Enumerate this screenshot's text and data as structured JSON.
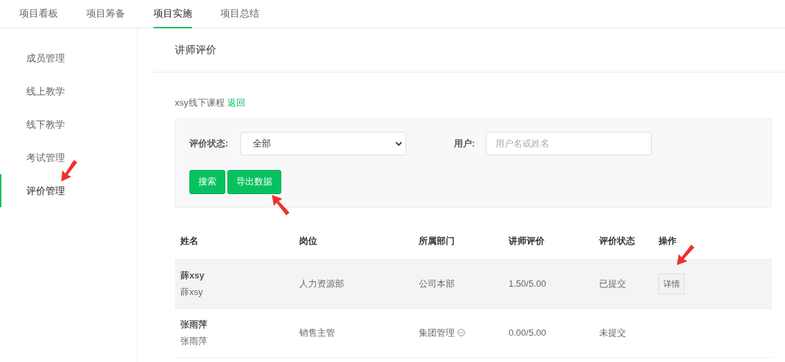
{
  "tabs": [
    {
      "label": "项目看板",
      "selected": false
    },
    {
      "label": "项目筹备",
      "selected": false
    },
    {
      "label": "项目实施",
      "selected": true
    },
    {
      "label": "项目总结",
      "selected": false
    }
  ],
  "sidebar": {
    "items": [
      {
        "label": "成员管理",
        "selected": false
      },
      {
        "label": "线上教学",
        "selected": false
      },
      {
        "label": "线下教学",
        "selected": false
      },
      {
        "label": "考试管理",
        "selected": false
      },
      {
        "label": "评价管理",
        "selected": true
      }
    ]
  },
  "page_title": "讲师评价",
  "course": {
    "name": "xsy线下课程",
    "back_link": "返回"
  },
  "filters": {
    "status_label": "评价状态:",
    "status_value": "全部",
    "user_label": "用户:",
    "user_placeholder": "用户名或姓名",
    "buttons": [
      "搜索",
      "导出数据"
    ]
  },
  "table": {
    "columns": [
      "姓名",
      "岗位",
      "所属部门",
      "讲师评价",
      "评价状态",
      "操作"
    ],
    "rows": [
      {
        "name": "薛xsy",
        "username": "薛xsy",
        "position": "人力资源部",
        "department": "公司本部",
        "info_icon": false,
        "rating": "1.50/5.00",
        "status": "已提交",
        "action": "详情",
        "selected": true
      },
      {
        "name": "张雨萍",
        "username": "张雨萍",
        "position": "销售主管",
        "department": "集团管理",
        "info_icon": true,
        "rating": "0.00/5.00",
        "status": "未提交",
        "selected": false
      }
    ]
  }
}
